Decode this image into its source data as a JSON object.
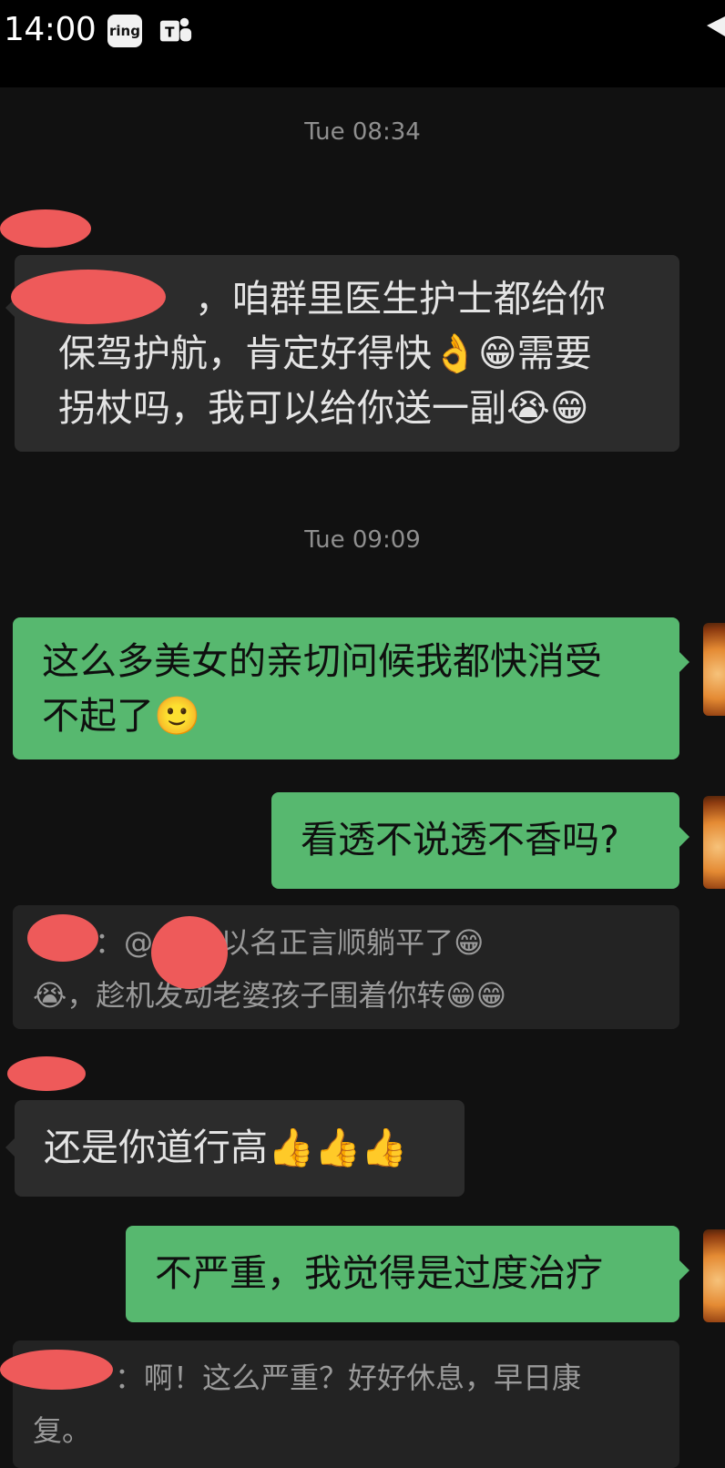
{
  "status_bar": {
    "time": "14:00",
    "ring_label": "ring",
    "icons": [
      "ring-icon",
      "teams-icon",
      "wifi-icon"
    ]
  },
  "messages": {
    "ts1": "Tue 08:34",
    "m1_line1": "，咱群里医生护士都给你",
    "m1_line2": "保驾护航，肯定好得快👌😁需要",
    "m1_line3": "拐杖吗，我可以给你送一副😭😁",
    "ts2": "Tue 09:09",
    "m2_line1": "这么多美女的亲切问候我都快消受",
    "m2_line2": "不起了🙂",
    "m3": "看透不说透不香吗?",
    "q1_line1": "：@     ，可以名正言顺躺平了😁",
    "q1_line2": "😭，趁机发动老婆孩子围着你转😁😁",
    "m4": "还是你道行高👍👍👍",
    "m5": "不严重，我觉得是过度治疗",
    "q2_line1": "：啊！这么严重？好好休息，早日康",
    "q2_line2": "复。"
  },
  "colors": {
    "background": "#111111",
    "received_bubble": "#2c2c2c",
    "sent_bubble": "#57b86f",
    "quote_bubble": "#232323",
    "redaction": "#ee5a5a"
  }
}
